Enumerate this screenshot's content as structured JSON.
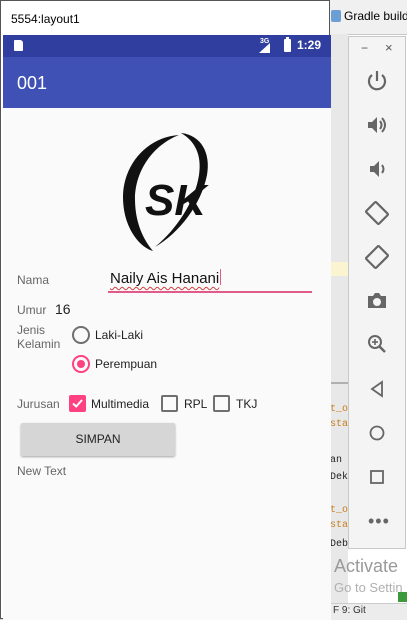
{
  "ide": {
    "title": "Gradle build",
    "code_lines": [
      "t_o",
      "sta",
      "an",
      "Dek",
      "t_o",
      "sta",
      "Deb"
    ],
    "bottom_text": "F 9: Git",
    "watermark_title": "Activate",
    "watermark_sub": "Go to Settin"
  },
  "emulator": {
    "window_title": "5554:layout1",
    "status_time": "1:29",
    "network": "3G"
  },
  "app": {
    "title": "001",
    "logo_text": "SK",
    "name_label": "Nama",
    "name_value": "Naily Ais Hanani",
    "age_label": "Umur",
    "age_value": "16",
    "gender_label": "Jenis\nKelamin",
    "gender_options": [
      {
        "label": "Laki-Laki",
        "selected": false
      },
      {
        "label": "Perempuan",
        "selected": true
      }
    ],
    "major_label": "Jurusan",
    "majors": [
      {
        "label": "Multimedia",
        "checked": true
      },
      {
        "label": "RPL",
        "checked": false
      },
      {
        "label": "TKJ",
        "checked": false
      }
    ],
    "save_button": "SIMPAN",
    "output_text": "New Text",
    "accent_color": "#ff4081",
    "primary_color": "#3f51b5"
  },
  "toolbar": {
    "minimize_label": "−",
    "close_label": "×",
    "icons": [
      "power-icon",
      "volume-up-icon",
      "volume-down-icon",
      "rotate-left-icon",
      "rotate-right-icon",
      "camera-icon",
      "zoom-icon",
      "back-icon",
      "home-icon",
      "overview-icon",
      "more-icon"
    ],
    "more_label": "•••"
  }
}
